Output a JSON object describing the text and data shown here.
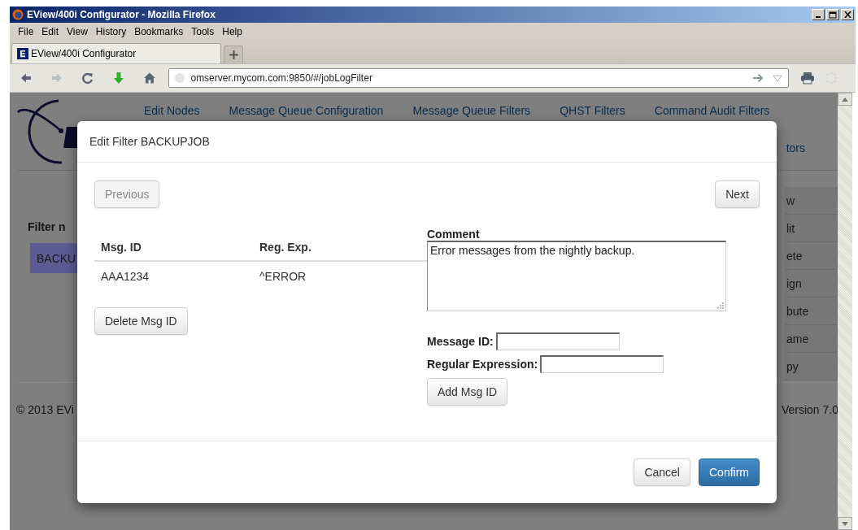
{
  "window": {
    "title": "EView/400i Configurator - Mozilla Firefox"
  },
  "menu_bar": [
    "File",
    "Edit",
    "View",
    "History",
    "Bookmarks",
    "Tools",
    "Help"
  ],
  "tabs": [
    {
      "label": "EView/400i Configurator",
      "selected": true
    }
  ],
  "address_bar": {
    "url": "omserver.mycom.com:9850/#/jobLogFilter"
  },
  "page": {
    "nav_links": [
      "Edit Nodes",
      "Message Queue Configuration",
      "Message Queue Filters",
      "QHST Filters",
      "Command Audit Filters"
    ],
    "nav_links_row2": [
      "tors"
    ],
    "filter_heading": "Filter n",
    "filters": [
      {
        "label": "BACKU",
        "selected": true
      }
    ],
    "actions": [
      "w",
      "lit",
      "ete",
      "ign",
      "bute",
      "ame",
      "py"
    ],
    "footer": {
      "copyright": "© 2013 EVi",
      "version": "Version 7.0"
    }
  },
  "dialog": {
    "title": "Edit Filter BACKUPJOB",
    "previous": {
      "label": "Previous",
      "disabled": true
    },
    "next": {
      "label": "Next",
      "disabled": false
    },
    "table": {
      "columns": [
        "Msg. ID",
        "Reg. Exp."
      ],
      "rows": [
        [
          "AAA1234",
          "^ERROR"
        ]
      ]
    },
    "delete_button": "Delete Msg ID",
    "comment": {
      "label": "Comment",
      "value": "Error messages from the nightly backup."
    },
    "message_id": {
      "label": "Message ID:"
    },
    "regular_expression": {
      "label": "Regular Expression:"
    },
    "add_button": "Add Msg ID",
    "buttons": [
      {
        "label": "Cancel",
        "kind": "default"
      },
      {
        "label": "Confirm",
        "kind": "primary"
      }
    ]
  }
}
